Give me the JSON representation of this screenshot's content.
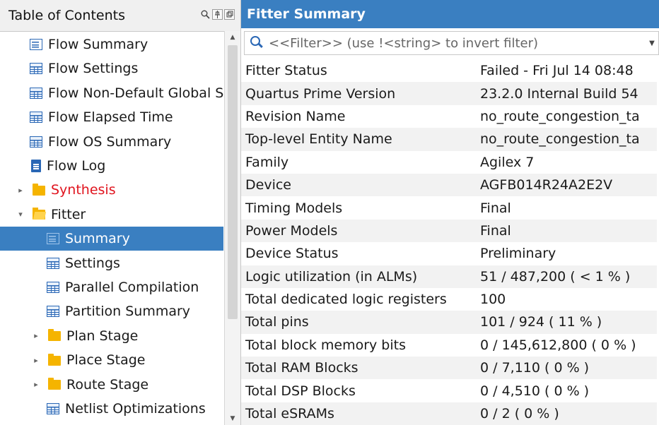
{
  "toc": {
    "title": "Table of Contents",
    "header_icons": [
      "search-icon",
      "pin-icon",
      "float-icon"
    ],
    "items": [
      {
        "label": "Flow Summary",
        "icon": "list-icon",
        "level": 1
      },
      {
        "label": "Flow Settings",
        "icon": "table-icon",
        "level": 1
      },
      {
        "label": "Flow Non-Default Global Settings",
        "icon": "table-icon",
        "level": 1
      },
      {
        "label": "Flow Elapsed Time",
        "icon": "table-icon",
        "level": 1
      },
      {
        "label": "Flow OS Summary",
        "icon": "table-icon",
        "level": 1
      },
      {
        "label": "Flow Log",
        "icon": "document-icon",
        "level": 1
      },
      {
        "label": "Synthesis",
        "icon": "folder-icon",
        "level": 0,
        "expander": "collapsed",
        "color": "#e0141e"
      },
      {
        "label": "Fitter",
        "icon": "folder-open-icon",
        "level": 0,
        "expander": "expanded"
      },
      {
        "label": "Summary",
        "icon": "list-icon",
        "level": 2,
        "selected": true
      },
      {
        "label": "Settings",
        "icon": "table-icon",
        "level": 2
      },
      {
        "label": "Parallel Compilation",
        "icon": "table-icon",
        "level": 2
      },
      {
        "label": "Partition Summary",
        "icon": "table-icon",
        "level": 2
      },
      {
        "label": "Plan Stage",
        "icon": "folder-icon",
        "level": 1,
        "expander": "collapsed"
      },
      {
        "label": "Place Stage",
        "icon": "folder-icon",
        "level": 1,
        "expander": "collapsed"
      },
      {
        "label": "Route Stage",
        "icon": "folder-icon",
        "level": 1,
        "expander": "collapsed"
      },
      {
        "label": "Netlist Optimizations",
        "icon": "table-icon",
        "level": 2
      }
    ]
  },
  "panel": {
    "title": "Fitter Summary",
    "filter_placeholder": "<<Filter>> (use !<string> to invert filter)",
    "rows": [
      {
        "key": "Fitter Status",
        "value": "Failed - Fri Jul 14 08:48"
      },
      {
        "key": "Quartus Prime Version",
        "value": "23.2.0 Internal Build 54"
      },
      {
        "key": "Revision Name",
        "value": "no_route_congestion_ta"
      },
      {
        "key": "Top-level Entity Name",
        "value": "no_route_congestion_ta"
      },
      {
        "key": "Family",
        "value": "Agilex 7"
      },
      {
        "key": "Device",
        "value": "AGFB014R24A2E2V"
      },
      {
        "key": "Timing Models",
        "value": "Final"
      },
      {
        "key": "Power Models",
        "value": "Final"
      },
      {
        "key": "Device Status",
        "value": "Preliminary"
      },
      {
        "key": "Logic utilization (in ALMs)",
        "value": "51 / 487,200 ( < 1 % )"
      },
      {
        "key": "Total dedicated logic registers",
        "value": "100"
      },
      {
        "key": "Total pins",
        "value": "101 / 924 ( 11 % )"
      },
      {
        "key": "Total block memory bits",
        "value": "0 / 145,612,800 ( 0 % )"
      },
      {
        "key": "Total RAM Blocks",
        "value": "0 / 7,110 ( 0 % )"
      },
      {
        "key": "Total DSP Blocks",
        "value": "0 / 4,510 ( 0 % )"
      },
      {
        "key": "Total eSRAMs",
        "value": "0 / 2 ( 0 % )"
      }
    ]
  },
  "colors": {
    "accent": "#3a7fc1",
    "folder": "#f5b400",
    "icon_blue": "#2a67b5",
    "error_red": "#e0141e"
  }
}
